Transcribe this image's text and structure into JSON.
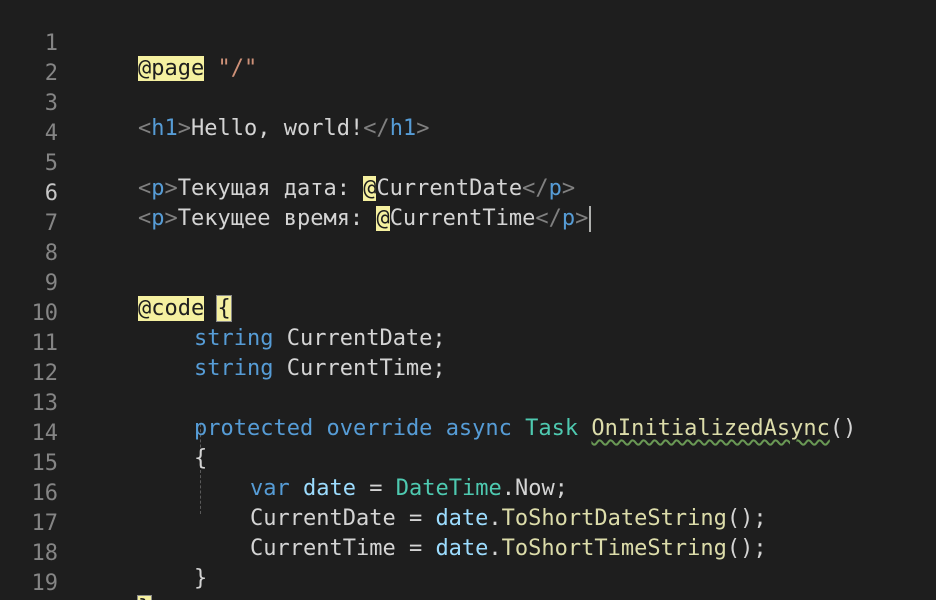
{
  "editor": {
    "line_numbers": [
      "1",
      "2",
      "3",
      "4",
      "5",
      "6",
      "7",
      "8",
      "9",
      "10",
      "11",
      "12",
      "13",
      "14",
      "15",
      "16",
      "17",
      "18",
      "19"
    ],
    "active_line": "6",
    "l1": {
      "directive": "@page",
      "route": "\"/\""
    },
    "l3": {
      "open_lt": "<",
      "open_tag": "h1",
      "open_gt": ">",
      "text": "Hello, world!",
      "close_lt": "</",
      "close_tag": "h1",
      "close_gt": ">"
    },
    "l5": {
      "open_lt": "<",
      "open_tag": "p",
      "open_gt": ">",
      "text": "Текущая дата: ",
      "at": "@",
      "var": "CurrentDate",
      "close_lt": "</",
      "close_tag": "p",
      "close_gt": ">"
    },
    "l6": {
      "open_lt": "<",
      "open_tag": "p",
      "open_gt": ">",
      "text": "Текущее время: ",
      "at": "@",
      "var": "CurrentTime",
      "close_lt": "</",
      "close_tag": "p",
      "close_gt": ">"
    },
    "l9": {
      "directive": "@code",
      "brace": "{"
    },
    "l10": {
      "kw": "string",
      "rest": " CurrentDate;"
    },
    "l11": {
      "kw": "string",
      "rest": " CurrentTime;"
    },
    "l13": {
      "kw1": "protected",
      "kw2": "override",
      "kw3": "async",
      "type": "Task",
      "fn": "OnInitializedAsync",
      "parens": "()"
    },
    "l14": {
      "brace": "{"
    },
    "l15": {
      "kw": "var",
      "var": "date",
      "eq": " = ",
      "type": "DateTime",
      "rest": ".Now;"
    },
    "l16": {
      "lhs": "CurrentDate = ",
      "var": "date",
      "dot": ".",
      "fn": "ToShortDateString",
      "rest": "();"
    },
    "l17": {
      "lhs": "CurrentTime = ",
      "var": "date",
      "dot": ".",
      "fn": "ToShortTimeString",
      "rest": "();"
    },
    "l18": {
      "brace": "}"
    },
    "l19": {
      "brace": "}"
    }
  }
}
